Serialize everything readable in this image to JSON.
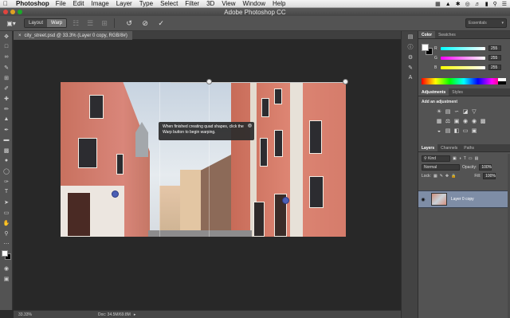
{
  "menubar": {
    "app_name": "Photoshop",
    "items": [
      "File",
      "Edit",
      "Image",
      "Layer",
      "Type",
      "Select",
      "Filter",
      "3D",
      "View",
      "Window",
      "Help"
    ]
  },
  "window": {
    "title": "Adobe Photoshop CC"
  },
  "options_bar": {
    "mode_tabs": [
      "Layout",
      "Warp"
    ],
    "active_mode": "Warp",
    "workspace": "Essentials"
  },
  "document": {
    "tab_label": "city_street.psd @ 33.3% (Layer 0 copy, RGB/8#)",
    "tooltip": "When finished creating quad shapes, click the Warp button to begin warping.",
    "status_zoom": "33.33%",
    "status_doc": "Doc: 34.5M/69.8M"
  },
  "color_panel": {
    "tabs": [
      "Color",
      "Swatches"
    ],
    "channels": [
      {
        "label": "R",
        "value": "255"
      },
      {
        "label": "G",
        "value": "255"
      },
      {
        "label": "B",
        "value": "255"
      }
    ]
  },
  "adjustments_panel": {
    "tabs": [
      "Adjustments",
      "Styles"
    ],
    "header": "Add an adjustment"
  },
  "layers_panel": {
    "tabs": [
      "Layers",
      "Channels",
      "Paths"
    ],
    "kind_filter": "Kind",
    "blend_mode": "Normal",
    "opacity_label": "Opacity:",
    "opacity_value": "100%",
    "lock_label": "Lock:",
    "fill_label": "Fill:",
    "fill_value": "100%",
    "layer_name": "Layer 0 copy"
  },
  "colors": {
    "app_bg": "#535353",
    "canvas_bg": "#282828",
    "selected_layer": "#7e8da6",
    "warp_anchor": "#4b5fb5"
  }
}
